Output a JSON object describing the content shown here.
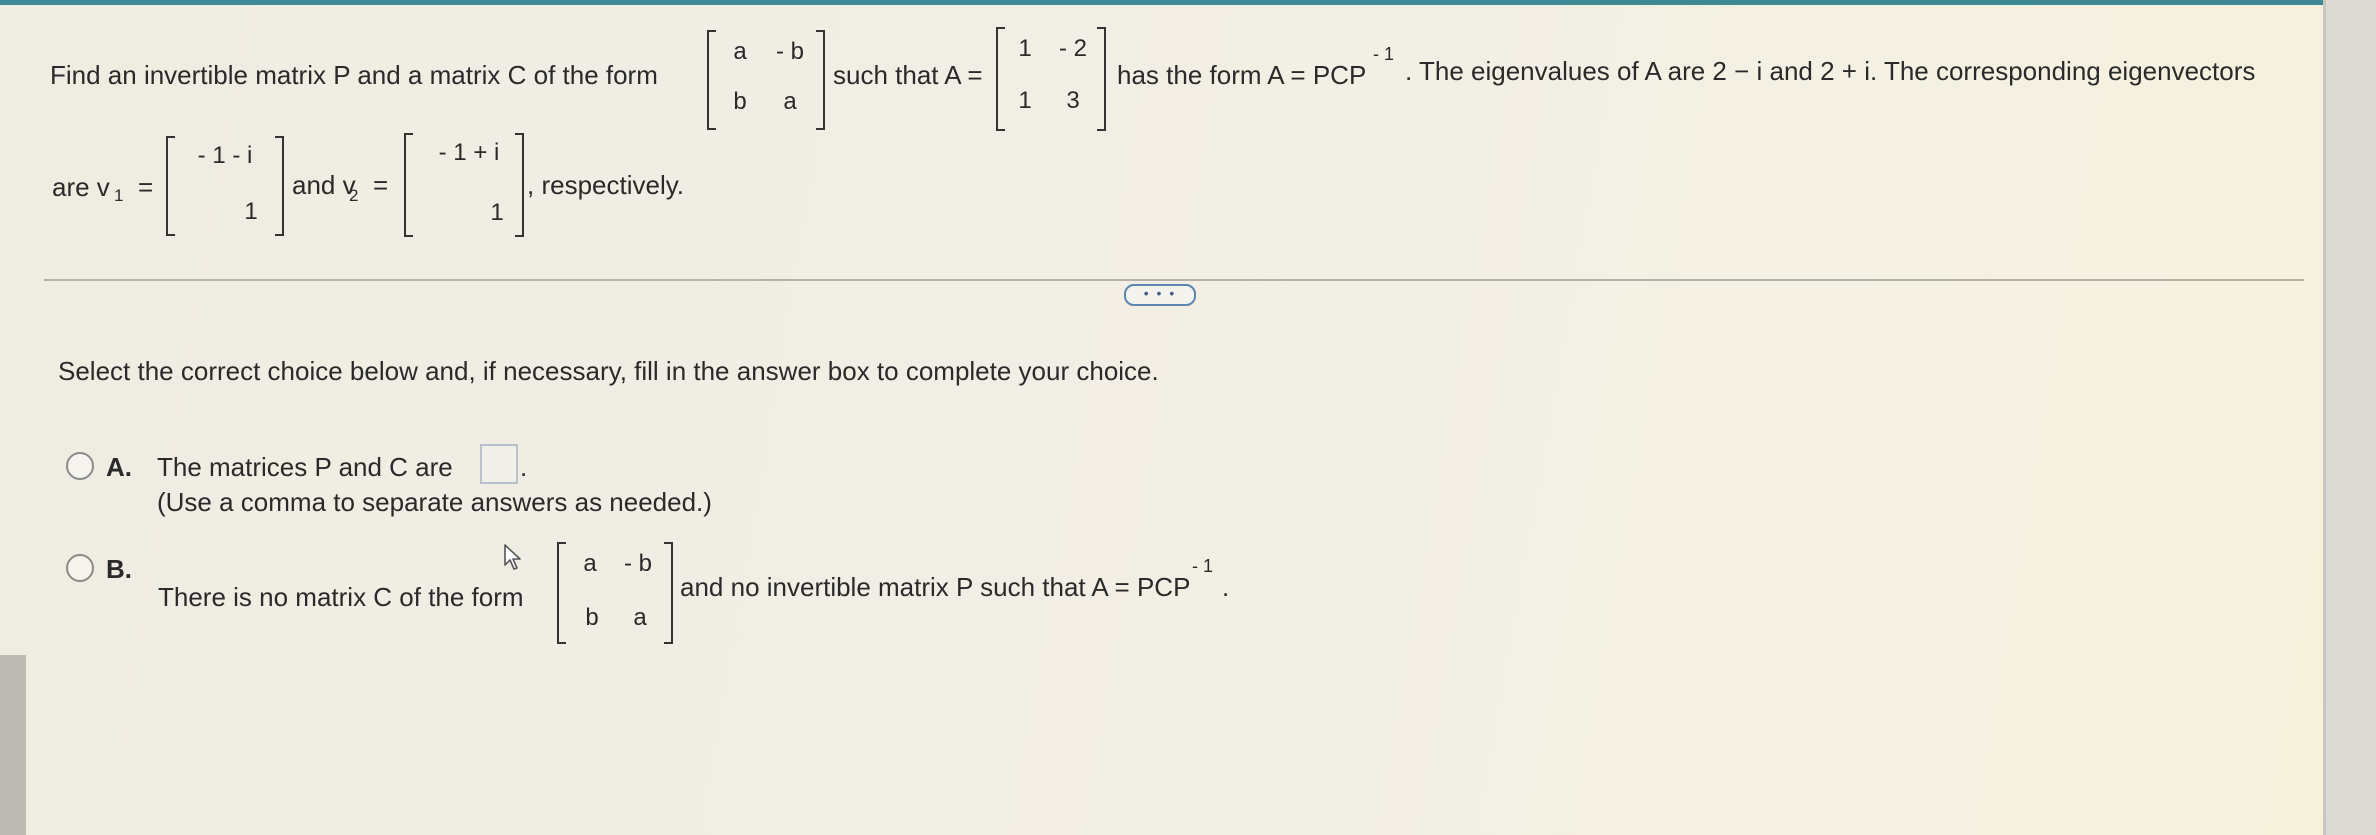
{
  "question": {
    "intro": "Find an invertible matrix P and a matrix C of the form",
    "form_matrix": [
      [
        "a",
        "- b"
      ],
      [
        "b",
        "a"
      ]
    ],
    "such_that": "such that A =",
    "matrix_A": [
      [
        "1",
        "- 2"
      ],
      [
        "1",
        "3"
      ]
    ],
    "has_form": "has the form A = PCP",
    "exp": "- 1",
    "eigen_sentence": ". The eigenvalues of A are 2 − i and 2 + i. The corresponding eigenvectors",
    "are_v": "are v",
    "v1_sub": "1",
    "eq": "=",
    "v1": [
      "- 1 - i",
      "1"
    ],
    "and_v": "and v",
    "v2_sub": "2",
    "v2": [
      "- 1 + i",
      "1"
    ],
    "respectively": ", respectively."
  },
  "more_button_label": "• • •",
  "instruction": "Select the correct choice below and, if necessary, fill in the answer box to complete your choice.",
  "choices": [
    {
      "letter": "A.",
      "text": "The matrices P and C are",
      "hint": "(Use a comma to separate answers as needed.)"
    },
    {
      "letter": "B.",
      "text_before": "There is no matrix C of the form",
      "form_matrix": [
        [
          "a",
          "- b"
        ],
        [
          "b",
          "a"
        ]
      ],
      "text_after": "and no invertible matrix P such that A = PCP",
      "exp": "- 1",
      "period": "."
    }
  ],
  "colors": {
    "accent": "#3d8a94",
    "button_border": "#5a86b0"
  }
}
